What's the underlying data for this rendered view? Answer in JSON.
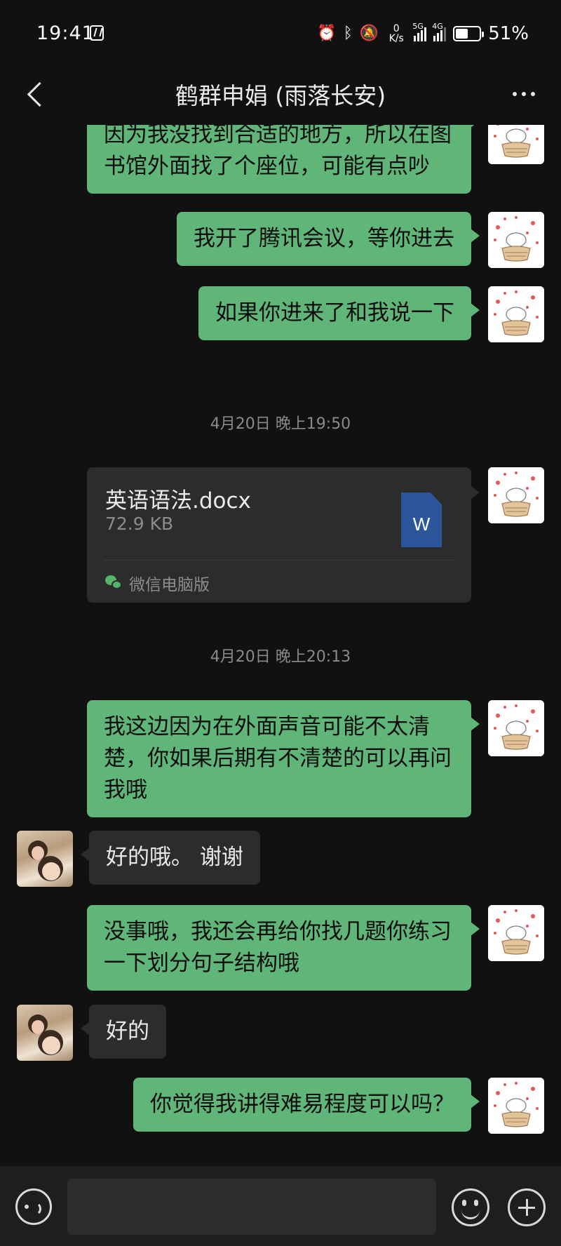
{
  "status_bar": {
    "time": "19:41",
    "net_speed_value": "0",
    "net_speed_unit": "K/s",
    "signal1_tag": "5G",
    "signal2_tag": "4G",
    "battery_level": 0.51,
    "battery_pct": "51%",
    "icons": [
      "nfc-icon",
      "alarm-icon",
      "bluetooth-icon",
      "mute-icon",
      "signal-icon",
      "battery-icon"
    ]
  },
  "header": {
    "title": "鹤群申娟 (雨落长安)",
    "icons": [
      "back-icon",
      "more-icon"
    ]
  },
  "messages": {
    "m1": "因为我没找到合适的地方，所以在图书馆外面找了个座位，可能有点吵",
    "m2": "我开了腾讯会议，等你进去",
    "m3": "如果你进来了和我说一下",
    "stamp1": "4月20日 晚上19:50",
    "file": {
      "name": "英语语法.docx",
      "size": "72.9 KB",
      "icon_letter": "W",
      "source": "微信电脑版"
    },
    "stamp2": "4月20日 晚上20:13",
    "m4": "我这边因为在外面声音可能不太清楚，你如果后期有不清楚的可以再问我哦",
    "m5": "好的哦。 谢谢",
    "m6": "没事哦，我还会再给你找几题你练习一下划分句子结构哦",
    "m7": "好的",
    "m8": "你觉得我讲得难易程度可以吗？"
  },
  "input_bar": {
    "message_value": "",
    "icons": [
      "voice-icon",
      "emoji-icon",
      "plus-icon"
    ]
  },
  "colors": {
    "background": "#111111",
    "my_bubble": "#5fb678",
    "other_bubble": "#2c2c2c",
    "input_bar": "#1e1e1e",
    "word_icon": "#2b579a"
  }
}
